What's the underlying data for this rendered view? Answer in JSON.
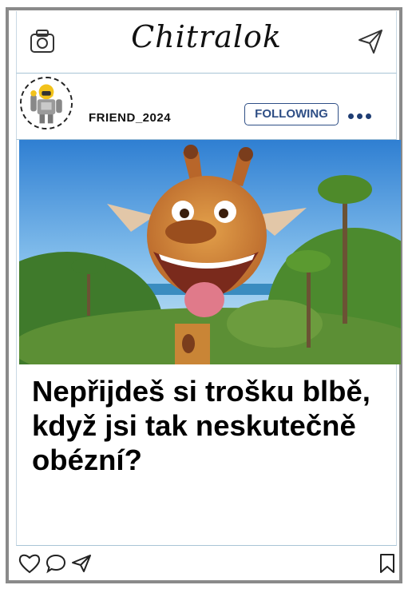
{
  "app": {
    "logo_text": "Chitralok"
  },
  "post": {
    "username": "FRIEND_2024",
    "follow_label": "FOLLOWING",
    "caption": "Nepřijdeš si trošku blbě, když jsi tak neskutečně obézní?"
  },
  "icons": {
    "header_left": "camera-icon",
    "header_right": "send-icon",
    "more": "more-dots-icon",
    "like": "heart-icon",
    "comment": "comment-icon",
    "share": "send-icon",
    "save": "bookmark-icon"
  },
  "colors": {
    "frame": "#8a8a8a",
    "accent": "#2f4f86",
    "divider": "#a9c4d6"
  }
}
